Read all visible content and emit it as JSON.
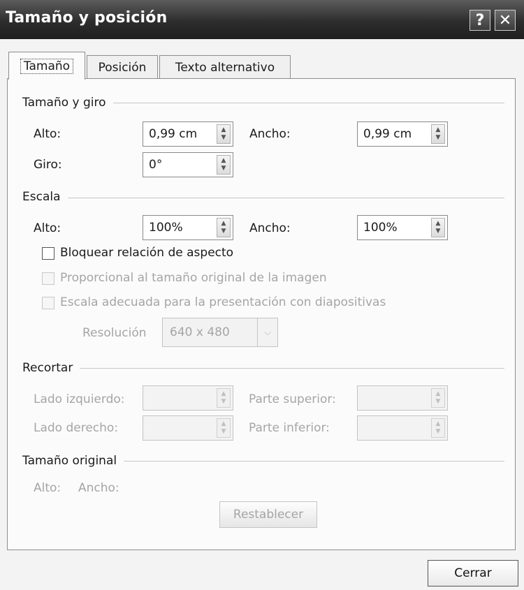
{
  "window": {
    "title": "Tamaño y posición",
    "help_glyph": "?",
    "close_glyph": "✕"
  },
  "tabs": [
    {
      "label": "Tamaño",
      "active": true
    },
    {
      "label": "Posición",
      "active": false
    },
    {
      "label": "Texto alternativo",
      "active": false
    }
  ],
  "size_rotation": {
    "header": "Tamaño y giro",
    "height_label": "Alto:",
    "height_value": "0,99 cm",
    "width_label": "Ancho:",
    "width_value": "0,99 cm",
    "rotation_label": "Giro:",
    "rotation_value": "0°"
  },
  "scale": {
    "header": "Escala",
    "height_label": "Alto:",
    "height_value": "100%",
    "width_label": "Ancho:",
    "width_value": "100%",
    "lock_aspect_label": "Bloquear relación de aspecto",
    "relative_original_label": "Proporcional al tamaño original de la imagen",
    "best_scale_label": "Escala adecuada para la presentación con diapositivas",
    "resolution_label": "Resolución",
    "resolution_value": "640 x 480"
  },
  "crop": {
    "header": "Recortar",
    "left_label": "Lado izquierdo:",
    "top_label": "Parte superior:",
    "right_label": "Lado derecho:",
    "bottom_label": "Parte inferior:"
  },
  "original_size": {
    "header": "Tamaño original",
    "height_label": "Alto:",
    "width_label": "Ancho:",
    "reset_label": "Restablecer"
  },
  "footer": {
    "close_label": "Cerrar"
  },
  "icons": {
    "spin_up": "▲",
    "spin_down": "▼",
    "dropdown": "⌵"
  },
  "colors": {
    "titlebar": "#2d2d2d",
    "disabled_text": "#a5a5a5",
    "panel": "#fbfbfb"
  }
}
